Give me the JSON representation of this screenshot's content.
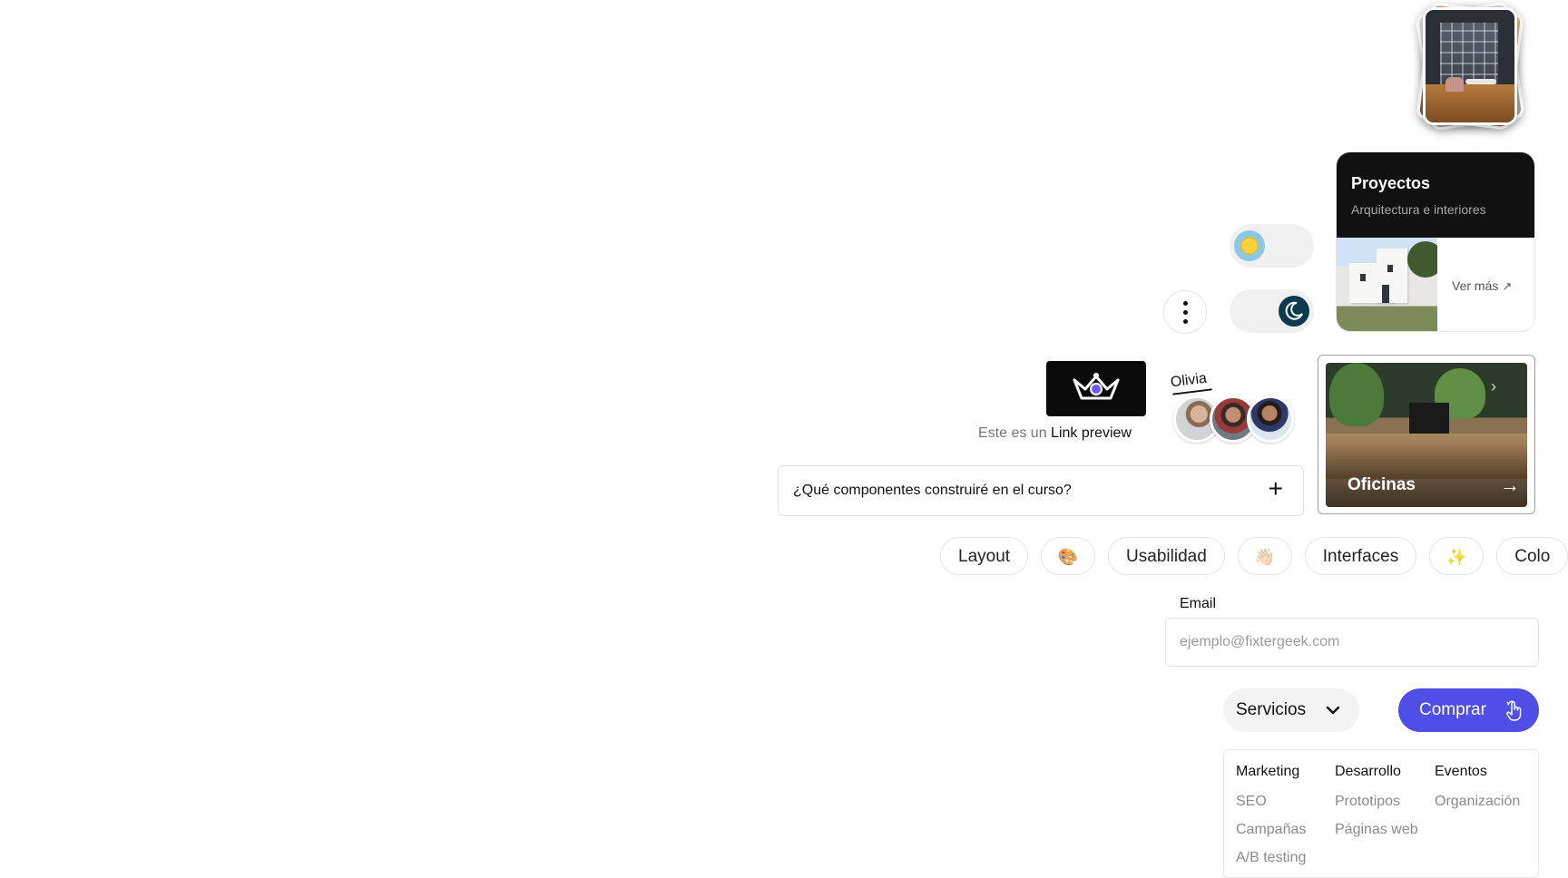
{
  "project_card": {
    "title": "Proyectos",
    "subtitle": "Arquitectura e interiores",
    "link": "Ver más",
    "link_icon": "arrow-up-right-icon"
  },
  "theme_toggles": [
    {
      "name": "light",
      "icon": "sun-icon",
      "on": true
    },
    {
      "name": "dark",
      "icon": "moon-icon",
      "on": true
    }
  ],
  "more_button": {
    "icon": "kebab-vertical-icon"
  },
  "link_preview": {
    "prefix": "Este es un ",
    "link": "Link preview"
  },
  "avatars": {
    "label": "Olivia",
    "count": 3
  },
  "offices_card": {
    "label": "Oficinas",
    "icon": "arrow-right-icon"
  },
  "faq": {
    "question": "¿Qué componentes construiré en el curso?",
    "expand": "+"
  },
  "tags": [
    {
      "text": "Layout"
    },
    {
      "text": "🎨",
      "icon": "palette-icon"
    },
    {
      "text": "Usabilidad"
    },
    {
      "text": "👋🏻",
      "icon": "hand-icon"
    },
    {
      "text": "Interfaces"
    },
    {
      "text": "✨",
      "icon": "sparkles-icon"
    },
    {
      "text": "Colo"
    }
  ],
  "email": {
    "label": "Email",
    "placeholder": "ejemplo@fixtergeek.com"
  },
  "services_dropdown": {
    "label": "Servicios",
    "icon": "chevron-down-icon"
  },
  "buy_button": {
    "label": "Comprar",
    "icon": "pointer-hand-icon",
    "color": "#4f4fe8"
  },
  "menu": {
    "columns": [
      {
        "heading": "Marketing",
        "items": [
          "SEO",
          "Campañas",
          "A/B testing"
        ]
      },
      {
        "heading": "Desarrollo",
        "items": [
          "Prototipos",
          "Páginas web"
        ]
      },
      {
        "heading": "Eventos",
        "items": [
          "Organización"
        ]
      }
    ]
  },
  "colors": {
    "dark": "#111111",
    "muted": "#8a8a8a",
    "accent": "#4f4fe8",
    "pill_bg": "#f0f0f0"
  }
}
